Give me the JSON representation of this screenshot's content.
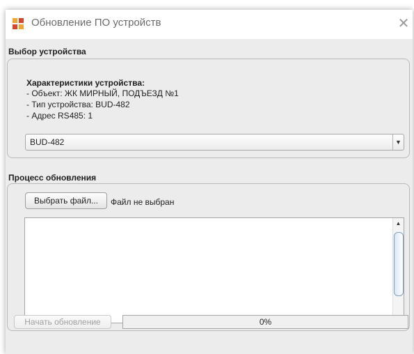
{
  "window": {
    "title": "Обновление ПО устройств",
    "icon": "app-grid-icon",
    "close_icon": "close-icon"
  },
  "device_selection": {
    "section_title": "Выбор устройства",
    "info_heading": "Характеристики устройства:",
    "info_lines": [
      "- Объект: ЖК МИРНЫЙ, ПОДЪЕЗД №1",
      "- Тип устройства: BUD-482",
      "- Адрес RS485: 1"
    ],
    "device_select": {
      "value": "BUD-482",
      "arrow_icon": "triangle-down-icon"
    }
  },
  "update_process": {
    "section_title": "Процесс обновления",
    "choose_file_label": "Выбрать файл...",
    "file_status": "Файл не выбран",
    "log_text": ""
  },
  "footer": {
    "start_label": "Начать обновление",
    "progress_fraction": 0,
    "progress_text": "0%"
  },
  "colors": {
    "panel_background": "#ececec",
    "border": "#b9b9b9",
    "progress_fill": "#7fa7d6",
    "icon_orange": "#f0a630",
    "icon_red": "#d9452b"
  }
}
